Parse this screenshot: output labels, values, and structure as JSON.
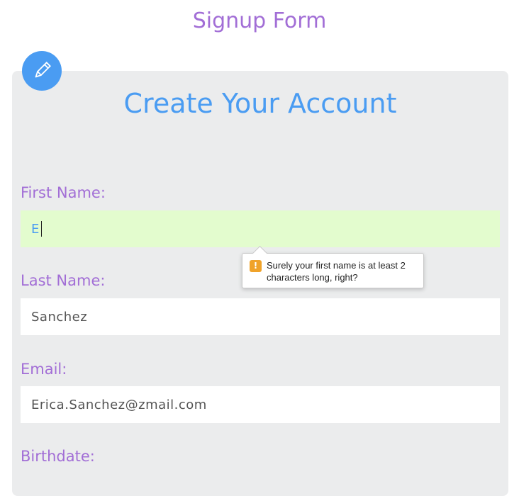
{
  "page": {
    "title": "Signup Form"
  },
  "card": {
    "title": "Create Your Account",
    "badge_icon": "pencil-icon",
    "accent_color": "#4a9cf2",
    "label_color": "#a26ed6"
  },
  "fields": {
    "first_name": {
      "label": "First Name:",
      "value": "E"
    },
    "last_name": {
      "label": "Last Name:",
      "value": "Sanchez"
    },
    "email": {
      "label": "Email:",
      "value": "Erica.Sanchez@zmail.com"
    },
    "birthdate": {
      "label": "Birthdate:"
    }
  },
  "tooltip": {
    "icon": "warning-icon",
    "icon_glyph": "!",
    "message": "Surely your first name is at least 2 characters long, right?"
  }
}
